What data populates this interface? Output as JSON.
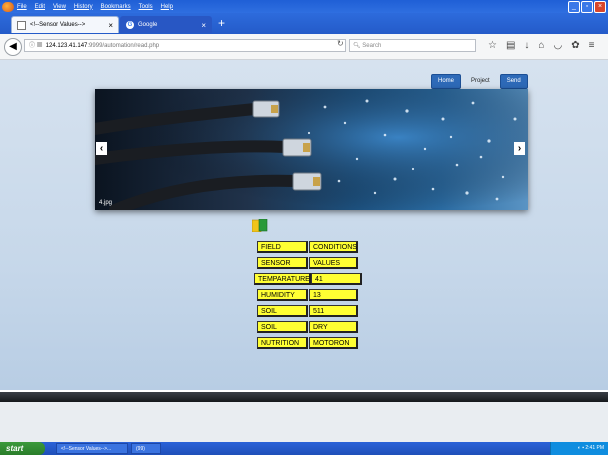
{
  "menu": {
    "items": [
      "File",
      "Edit",
      "View",
      "History",
      "Bookmarks",
      "Tools",
      "Help"
    ]
  },
  "tabs": [
    {
      "title": "<!--Sensor Values-->",
      "active": true
    },
    {
      "title": "Google",
      "active": false
    }
  ],
  "address": {
    "host": "124.123.41.147",
    "path": ":9999/automation/read.php"
  },
  "search": {
    "placeholder": "Search"
  },
  "site_nav": {
    "items": [
      "Home",
      "Project",
      "Send"
    ]
  },
  "banner": {
    "caption": "4.jpg"
  },
  "sensor_table": {
    "rows": [
      {
        "label": "FIELD",
        "value": "CONDITIONS"
      },
      {
        "label": "SENSOR",
        "value": "VALUES"
      },
      {
        "label": "TEMPARATURE",
        "value": "41"
      },
      {
        "label": "HUMIDITY",
        "value": "13"
      },
      {
        "label": "SOIL",
        "value": "511"
      },
      {
        "label": "SOIL",
        "value": "DRY"
      },
      {
        "label": "NUTRITION",
        "value": "MOTORON"
      }
    ]
  },
  "taskbar": {
    "start": "start",
    "tasks": [
      "<!--Sensor Values-->...",
      "(99)"
    ],
    "clock": "2:41 PM"
  },
  "colors": {
    "cell_yellow": "#ffff33",
    "nav_blue": "#2e6ab8",
    "taskbar_blue": "#245bc9"
  }
}
